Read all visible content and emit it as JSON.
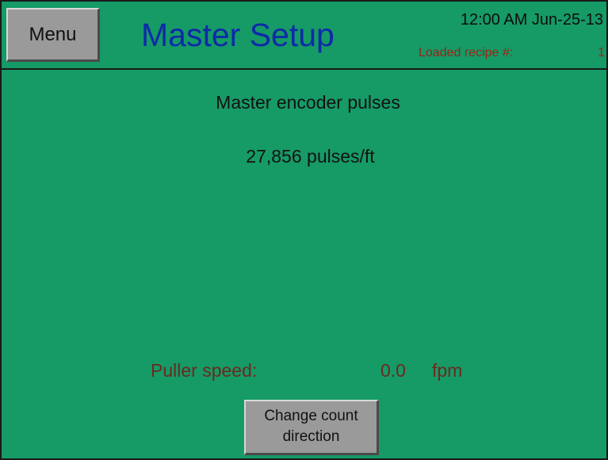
{
  "header": {
    "menu_label": "Menu",
    "title": "Master Setup",
    "datetime": "12:00 AM Jun-25-13",
    "recipe_label": "Loaded recipe #:",
    "recipe_value": "1"
  },
  "encoder": {
    "label": "Master encoder pulses",
    "value": "27,856 pulses/ft"
  },
  "puller": {
    "label": "Puller speed:",
    "value": "0.0",
    "unit": "fpm"
  },
  "change_count_button": {
    "line1": "Change count",
    "line2": "direction"
  },
  "colors": {
    "background": "#169a66",
    "title": "#0e2aa8",
    "recipe_text": "#9a2418",
    "puller_text": "#6a2a1f",
    "button_face": "#9a9a9a"
  }
}
